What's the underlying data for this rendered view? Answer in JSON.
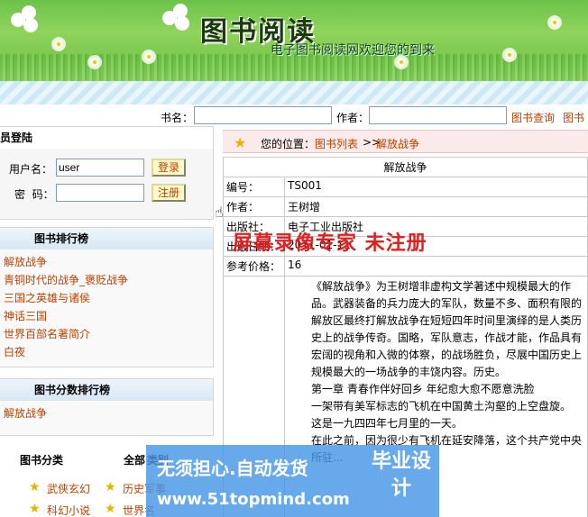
{
  "header": {
    "title": "图书阅读",
    "subtitle": "电子图书阅读网欢迎您的到来"
  },
  "search": {
    "book_label": "书名：",
    "author_label": "作者：",
    "query_link": "图书查询",
    "extra_link": "图书",
    "book_value": "",
    "author_value": ""
  },
  "login": {
    "heading": "员登陆",
    "username_label": "用户名：",
    "username_value": "user",
    "password_label": "密  码：",
    "password_value": "",
    "login_button": "登录",
    "register_button": "注册"
  },
  "ranking": {
    "heading": "图书排行榜",
    "items": [
      "解放战争",
      "青铜时代的战争_褒贬战争",
      "三国之英雄与诸侯",
      "神话三国",
      "世界百部名著简介",
      "白夜"
    ]
  },
  "score_ranking": {
    "heading": "图书分数排行榜",
    "items": [
      "解放战争"
    ]
  },
  "categories": {
    "heading": "图书分类",
    "all_label": "全部",
    "all_label_suffix": "类别",
    "items": [
      "武侠玄幻",
      "历史军事",
      "科幻小说",
      "世界名"
    ]
  },
  "location": {
    "label": "您的位置：",
    "crumb1": "图书列表",
    "sep": ">>",
    "crumb2": "解放战争"
  },
  "book": {
    "title": "解放战争",
    "id_label": "编号：",
    "id": "TS001",
    "author_label": "作者：",
    "author": "王树增",
    "publisher_label": "出版社：",
    "publisher": "电子工业出版社",
    "date_label": "出版日期：",
    "date": "2011-01-11",
    "price_label": "参考价格：",
    "price": "16",
    "desc": [
      "《解放战争》为王树增非虚构文学著述中规模最大的作品。武器装备的兵力庞大的军队，数量不多、面积有限的解放区最终打解放战争在短短四年时间里演绎的是人类历史上的战争传奇。国略，军队意志，作战才能，作品具有宏阔的视角和入微的体察，的战场胜负，尽展中国历史上规模最大的一场战争的丰饶内容。历史。",
      "第一章  青春作伴好回乡  年纪愈大愈不愿意洗脸",
      "一架带有美军标志的飞机在中国黄土沟壑的上空盘旋。",
      "这是一九四四年七月里的一天。",
      "在此之前，因为很少有飞机在延安降落，这个共产党中央所驻..."
    ]
  },
  "watermark": "屏幕录像专家  未注册",
  "ad": {
    "line1": "无须担心.自动发货",
    "line2": "www.51topmind.com",
    "line3": "毕业设计"
  }
}
